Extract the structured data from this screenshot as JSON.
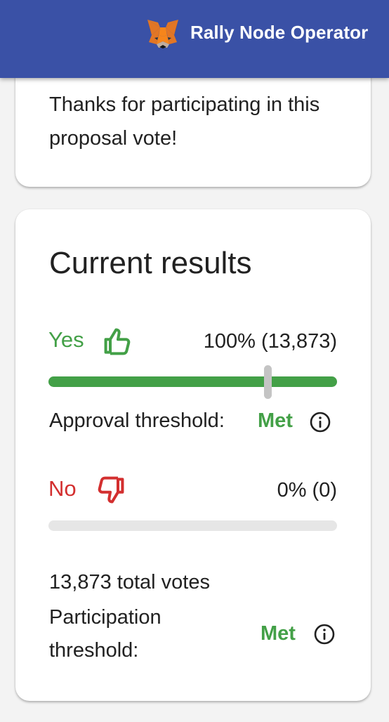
{
  "header": {
    "title": "Rally Node Operator",
    "logo_icon": "metamask-fox-icon",
    "background_color": "#3a51a6"
  },
  "thanks_card": {
    "message": "Thanks for participating in this proposal vote!"
  },
  "results": {
    "title": "Current results",
    "yes": {
      "label": "Yes",
      "icon": "thumb-up-icon",
      "value_text": "100% (13,873)",
      "fill_fraction": 1.0,
      "color": "#43a047"
    },
    "approval_threshold": {
      "label": "Approval threshold:",
      "status": "Met",
      "marker_fraction": 0.76
    },
    "no": {
      "label": "No",
      "icon": "thumb-down-icon",
      "value_text": "0% (0)",
      "fill_fraction": 0.0,
      "color": "#d32f2f"
    },
    "total_votes": "13,873 total votes",
    "participation_threshold": {
      "label": "Participation threshold:",
      "status": "Met"
    },
    "status_color": "#43a047"
  }
}
